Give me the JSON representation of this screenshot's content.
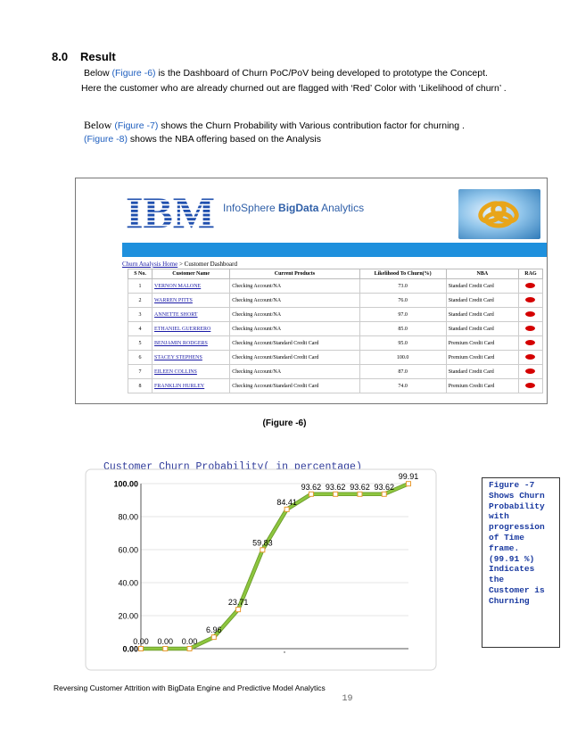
{
  "heading": {
    "number": "8.0",
    "title": "Result"
  },
  "p1": {
    "pre": "Below ",
    "fig": "(Figure -6)",
    "post": " is the Dashboard of Churn PoC/PoV being developed to prototype the Concept."
  },
  "p2": "Here the customer who are already churned out are flagged with ‘Red’ Color with ‘Likelihood of churn’ .",
  "p3": {
    "pre": "Below ",
    "fig": "(Figure -7)",
    "post": " shows the Churn Probability with Various contribution factor for churning ."
  },
  "p4": {
    "fig": "(Figure -8)",
    "post": " shows the NBA offering based on the Analysis"
  },
  "dashboard": {
    "logo": "IBM",
    "brand_pre": "InfoSphere ",
    "brand_bold": "BigData",
    "brand_post": " Analytics",
    "crumb_link": "Churn Analysis Home",
    "crumb_rest": " > Customer Dashboard",
    "columns": [
      "S No.",
      "Customer Name",
      "Current Products",
      "Likelihood To Churn(%)",
      "NBA",
      "RAG"
    ],
    "rows": [
      {
        "sno": "1",
        "name": "VERNON MALONE",
        "products": "Checking Account/NA",
        "likelihood": "73.0",
        "nba": "Standard Credit Card"
      },
      {
        "sno": "2",
        "name": "WARREN PITTS",
        "products": "Checking Account/NA",
        "likelihood": "76.0",
        "nba": "Standard Credit Card"
      },
      {
        "sno": "3",
        "name": "ANNETTE SHORT",
        "products": "Checking Account/NA",
        "likelihood": "97.0",
        "nba": "Standard Credit Card"
      },
      {
        "sno": "4",
        "name": "ETHANIEL GUERRERO",
        "products": "Checking Account/NA",
        "likelihood": "85.0",
        "nba": "Standard Credit Card"
      },
      {
        "sno": "5",
        "name": "BENJAMIN RODGERS",
        "products": "Checking Account/Standard Credit Card",
        "likelihood": "95.0",
        "nba": "Premium Credit Card"
      },
      {
        "sno": "6",
        "name": "STACEY STEPHENS",
        "products": "Checking Account/Standard Credit Card",
        "likelihood": "100.0",
        "nba": "Premium Credit Card"
      },
      {
        "sno": "7",
        "name": "EILEEN COLLINS",
        "products": "Checking Account/NA",
        "likelihood": "87.0",
        "nba": "Standard Credit Card"
      },
      {
        "sno": "8",
        "name": "FRANKLIN HURLEY",
        "products": "Checking Account/Standard Credit Card",
        "likelihood": "74.0",
        "nba": "Premium Credit Card"
      }
    ]
  },
  "caption6": "(Figure -6)",
  "chart_data": {
    "type": "line",
    "title": "Customer Churn Probability( in percentage)",
    "ylim": [
      0,
      100
    ],
    "yticks": [
      "0.00",
      "20.00",
      "40.00",
      "60.00",
      "80.00",
      "100.00"
    ],
    "values": [
      0,
      0,
      0,
      6.96,
      23.71,
      59.83,
      84.41,
      93.62,
      93.62,
      93.62,
      93.62,
      99.91
    ],
    "labels": [
      "0.00",
      "0.00",
      "0.00",
      "6.96",
      "23.71",
      "59.83",
      "84.41",
      "93.62",
      "93.62",
      "93.62",
      "93.62",
      "99.91"
    ],
    "grid": true,
    "colors": {
      "line": "#8dc63f",
      "marker": "#e89b32",
      "title": "#2f3b9a"
    }
  },
  "side_note": "Figure -7\nShows Churn\nProbability\nwith\nprogression\nof Time\nframe.\n(99.91 %)\nIndicates\nthe\nCustomer is\nChurning",
  "footer": "Reversing Customer Attrition with BigData Engine and Predictive Model  Analytics",
  "page_number": "19"
}
